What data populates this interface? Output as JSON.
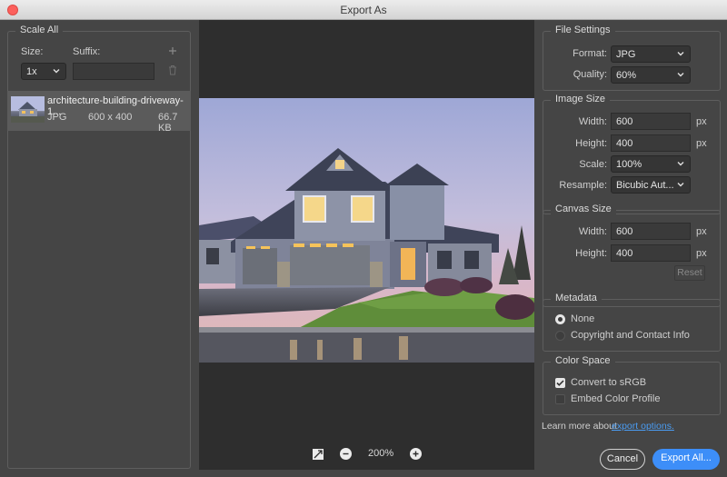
{
  "window": {
    "title": "Export As"
  },
  "scale_all": {
    "legend": "Scale All",
    "size_label": "Size:",
    "suffix_label": "Suffix:",
    "size_value": "1x",
    "suffix_value": "",
    "file": {
      "name": "architecture-building-driveway-1...",
      "format": "JPG",
      "dimensions": "600 x 400",
      "size": "66.7 KB"
    }
  },
  "preview": {
    "zoom": "200%"
  },
  "file_settings": {
    "legend": "File Settings",
    "format_label": "Format:",
    "format_value": "JPG",
    "quality_label": "Quality:",
    "quality_value": "60%"
  },
  "image_size": {
    "legend": "Image Size",
    "width_label": "Width:",
    "width_value": "600",
    "height_label": "Height:",
    "height_value": "400",
    "scale_label": "Scale:",
    "scale_value": "100%",
    "resample_label": "Resample:",
    "resample_value": "Bicubic Aut...",
    "unit": "px"
  },
  "canvas_size": {
    "legend": "Canvas Size",
    "width_label": "Width:",
    "width_value": "600",
    "height_label": "Height:",
    "height_value": "400",
    "unit": "px",
    "reset_label": "Reset"
  },
  "metadata": {
    "legend": "Metadata",
    "option_none": "None",
    "option_copyright": "Copyright and Contact Info",
    "selected": "None"
  },
  "color_space": {
    "legend": "Color Space",
    "convert_label": "Convert to sRGB",
    "convert_checked": true,
    "embed_label": "Embed Color Profile",
    "embed_checked": false
  },
  "footer": {
    "learn_more": "Learn more about",
    "link": "export options.",
    "cancel_label": "Cancel",
    "export_label": "Export All..."
  },
  "colors": {
    "accent": "#3d8ef8",
    "link": "#4a9cf2",
    "panel": "#454545",
    "preview_bg": "#2e2e2e"
  }
}
